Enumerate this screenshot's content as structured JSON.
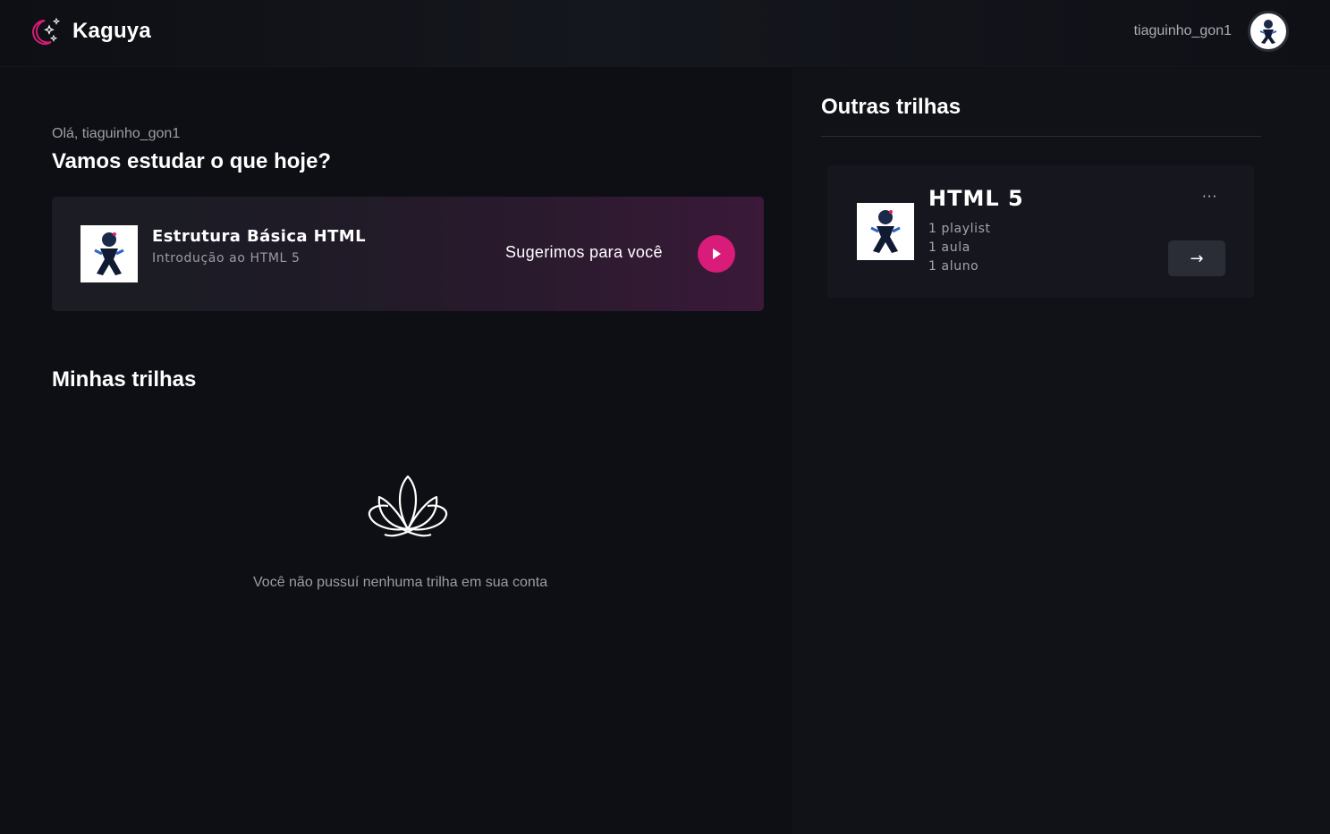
{
  "header": {
    "brand_name": "Kaguya",
    "username": "tiaguinho_gon1",
    "logo_icon": "moon-stars-icon"
  },
  "main": {
    "greeting": "Olá, tiaguinho_gon1",
    "question": "Vamos estudar o que hoje?",
    "suggestion": {
      "course_title": "Estrutura Básica HTML",
      "course_subtitle": "Introdução ao HTML 5",
      "label": "Sugerimos para você",
      "play_icon": "play-icon"
    },
    "my_tracks": {
      "title": "Minhas trilhas",
      "empty_icon": "lotus-icon",
      "empty_text": "Você não pussuí nenhuma trilha em sua conta"
    }
  },
  "sidebar": {
    "title": "Outras trilhas",
    "tracks": [
      {
        "name": "HTML 5",
        "playlists": "1 playlist",
        "lessons": "1 aula",
        "students": "1 aluno",
        "more_label": "···",
        "go_label": "→"
      }
    ]
  },
  "colors": {
    "accent": "#d91b79",
    "background": "#0f1015",
    "card": "#16171e"
  }
}
